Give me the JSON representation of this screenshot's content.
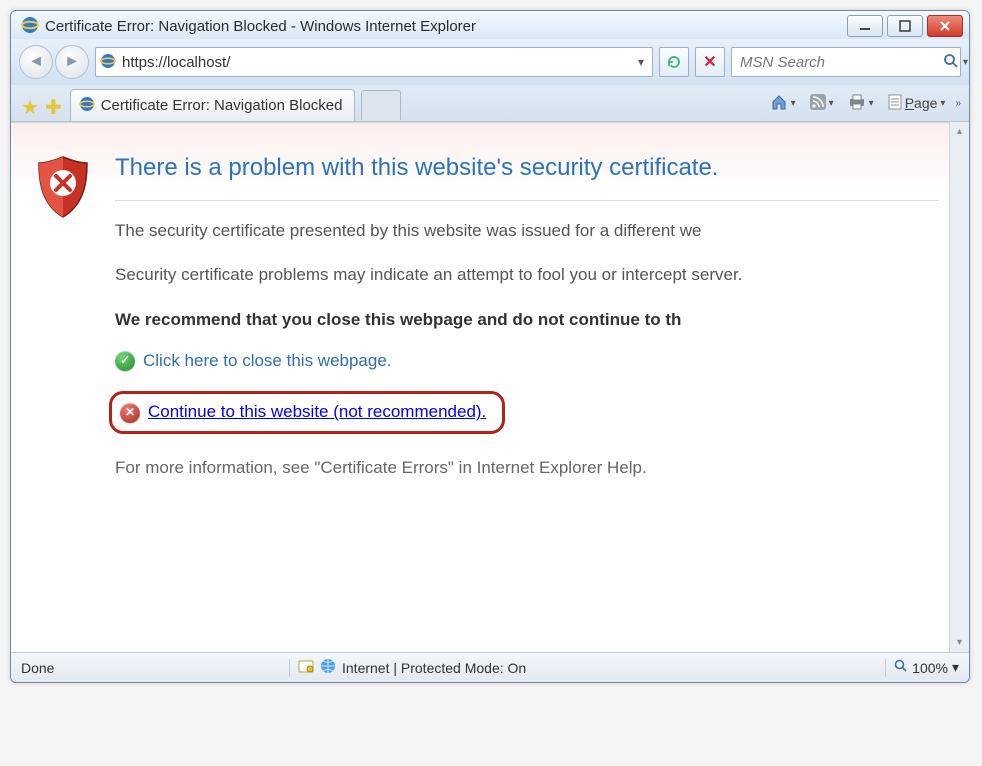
{
  "window": {
    "title": "Certificate Error: Navigation Blocked - Windows Internet Explorer"
  },
  "nav": {
    "url": "https://localhost/",
    "search_placeholder": "MSN Search"
  },
  "tab": {
    "label": "Certificate Error: Navigation Blocked"
  },
  "toolbar": {
    "page_label": "Page"
  },
  "page": {
    "heading": "There is a problem with this website's security certificate.",
    "para1": "The security certificate presented by this website was issued for a different we",
    "para2": "Security certificate problems may indicate an attempt to fool you or intercept server.",
    "recommend": "We recommend that you close this webpage and do not continue to th",
    "close_link": "Click here to close this webpage.",
    "continue_link": "Continue to this website (not recommended).",
    "moreinfo": "For more information, see \"Certificate Errors\" in Internet Explorer Help."
  },
  "status": {
    "left": "Done",
    "mid": "Internet | Protected Mode: On",
    "zoom": "100%"
  }
}
